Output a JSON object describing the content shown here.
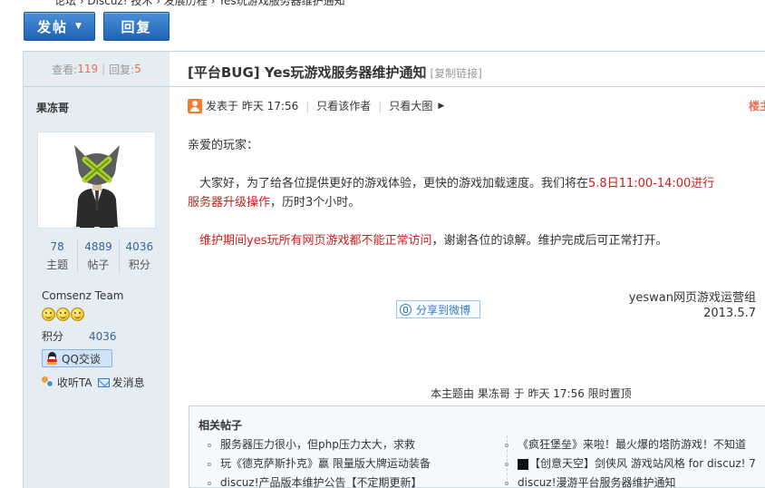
{
  "breadcrumb": "论坛 › Discuz! 技术 › 发展历程 › Yes玩游戏服务器维护通知",
  "toolbar": {
    "post_label": "发帖",
    "reply_label": "回复"
  },
  "thread_stats": {
    "views_label": "查看:",
    "views": "119",
    "replies_label": "回复:",
    "replies": "5"
  },
  "thread": {
    "title": "[平台BUG] Yes玩游戏服务器维护通知",
    "copy_link": "[复制链接]"
  },
  "author": {
    "name": "果冻哥",
    "stats": [
      {
        "value": "78",
        "label": "主题"
      },
      {
        "value": "4889",
        "label": "帖子"
      },
      {
        "value": "4036",
        "label": "积分"
      }
    ],
    "group": "Comsenz Team",
    "credits_label": "积分",
    "credits": "4036",
    "qq_label": "QQ交谈",
    "follow_label": "收听TA",
    "message_label": "发消息"
  },
  "post": {
    "posted_at": "发表于 昨天 17:56",
    "only_author": "只看该作者",
    "large_image": "只看大图",
    "floor": "楼主",
    "greeting": "亲爱的玩家：",
    "para1_a": "大家好，为了给各位提供更好的游戏体验，更快的游戏加载速度。我们将在",
    "para1_red": "5.8日11:00-14:00进行",
    "para1_red2": "服务器升级操作",
    "para1_b": "，历时3个小时。",
    "para2_red": "维护期间yes玩所有网页游戏都不能正常访问",
    "para2_b": "，谢谢各位的谅解。维护完成后可正常打开。",
    "signature_team": "yeswan网页游戏运营组",
    "signature_date": "2013.5.7",
    "share_label": "分享到微博",
    "sticky_note": "本主题由 果冻哥 于 昨天 17:56 限时置顶"
  },
  "related": {
    "title": "相关帖子",
    "left": [
      "服务器压力很小，但php压力太大，求救",
      "玩《德克萨斯扑克》赢 限量版大牌运动装备",
      "discuz!产品版本维护公告【不定期更新】"
    ],
    "right": [
      "《疯狂堡垒》来啦！最火爆的塔防游戏！不知道",
      "【创意天空】剑侠风 游戏站风格 for discuz! 7",
      "discuz!漫游平台服务器维护通知"
    ]
  },
  "colors": {
    "accent_blue": "#1f63b5",
    "sidebar_bg": "#e5edf2",
    "alert_red": "#cc1e1e",
    "count_orange": "#f26c4f"
  }
}
